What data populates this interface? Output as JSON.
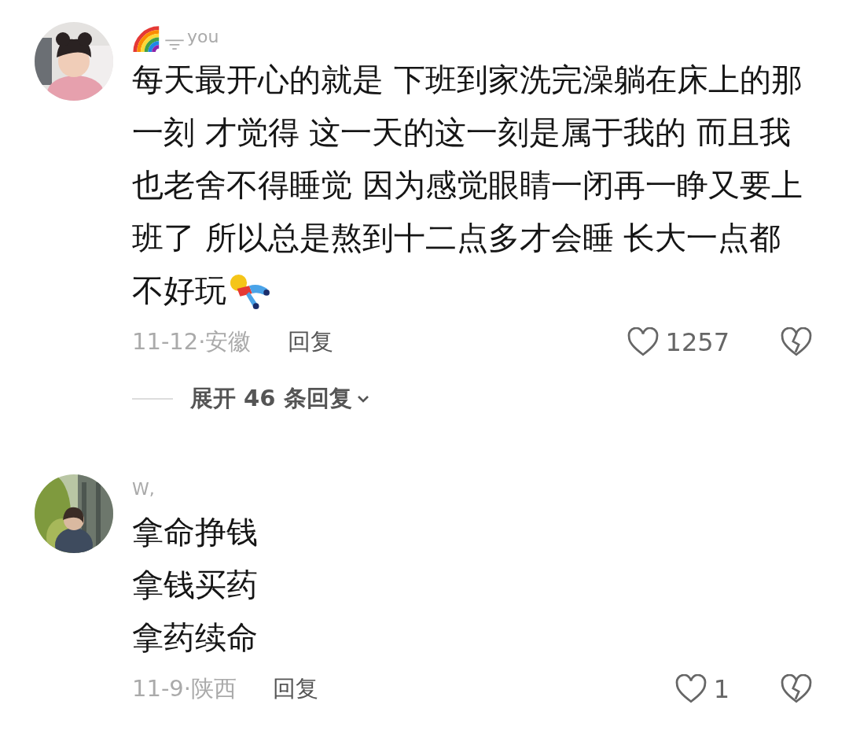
{
  "comments": [
    {
      "rainbow_badge": true,
      "name": "you",
      "lines": [
        "每天最开心的就是 下班到家洗完澡躺在床上的那",
        "一刻 才觉得 这一天的这一刻是属于我的 而且我",
        "也老舍不得睡觉 因为感觉眼睛一闭再一睁又要上",
        "班了 所以总是熬到十二点多才会睡 长大一点都",
        "不好玩"
      ],
      "sticker": true,
      "meta": "11-12·安徽",
      "reply": "回复",
      "likes": "1257",
      "replies": "展开 46 条回复"
    },
    {
      "rainbow_badge": false,
      "name": "W,",
      "lines": [
        "拿命挣钱",
        "拿钱买药",
        "拿药续命"
      ],
      "sticker": false,
      "meta": "11-9·陕西",
      "reply": "回复",
      "likes": "1"
    }
  ]
}
